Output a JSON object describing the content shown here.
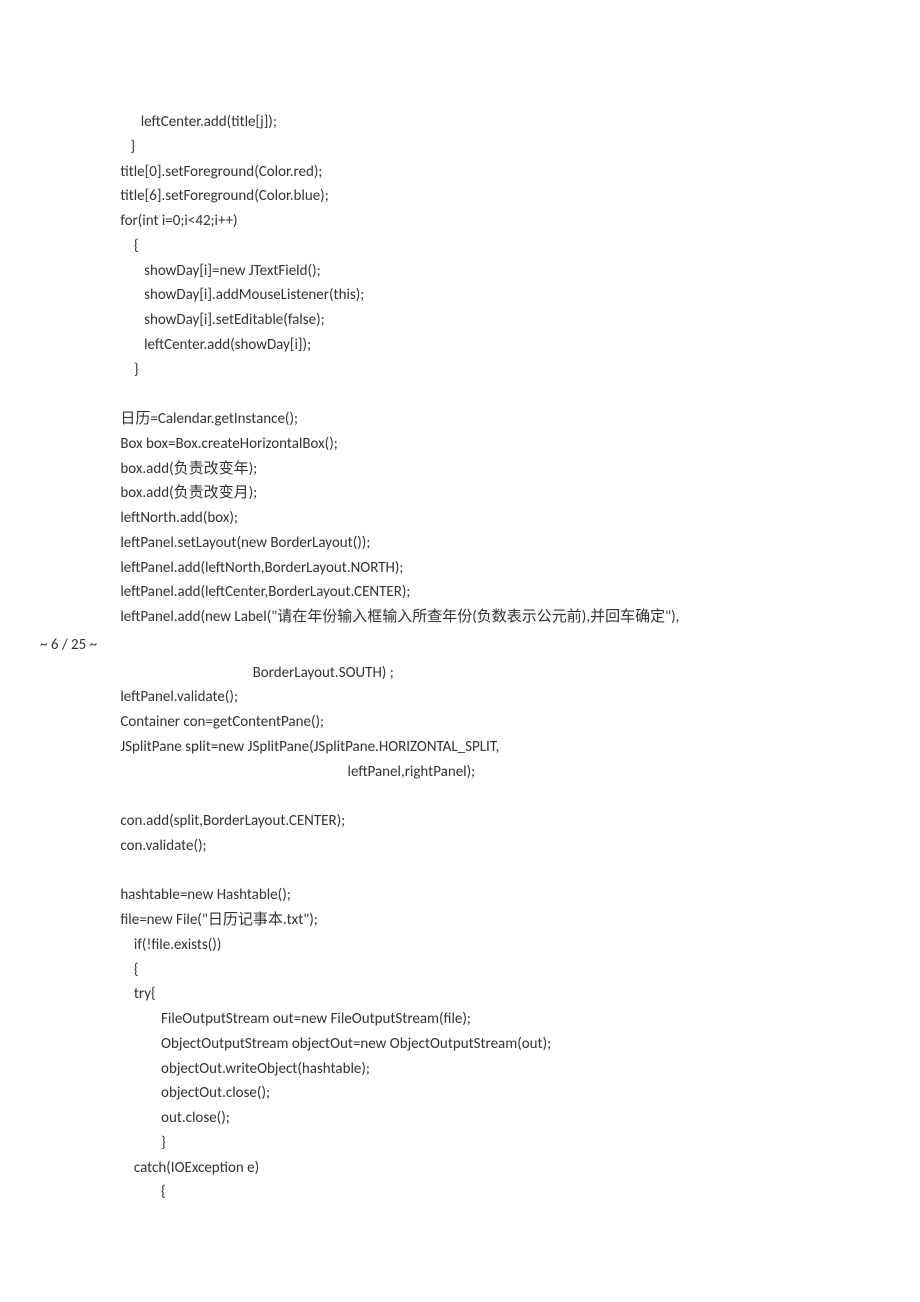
{
  "pageNumber": "~ 6 / 25 ~",
  "lines": [
    "            leftCenter.add(title[j]);",
    "         }",
    "      title[0].setForeground(Color.red);",
    "      title[6].setForeground(Color.blue);",
    "      for(int i=0;i<42;i++)",
    "          {",
    "             showDay[i]=new JTextField();",
    "             showDay[i].addMouseListener(this);",
    "             showDay[i].setEditable(false);",
    "             leftCenter.add(showDay[i]);",
    "          }",
    "",
    "      日历=Calendar.getInstance();",
    "      Box box=Box.createHorizontalBox();",
    "      box.add(负责改变年);",
    "      box.add(负责改变月);",
    "      leftNorth.add(box);",
    "      leftPanel.setLayout(new BorderLayout());",
    "      leftPanel.add(leftNorth,BorderLayout.NORTH);",
    "      leftPanel.add(leftCenter,BorderLayout.CENTER);",
    "      leftPanel.add(new Label(\"请在年份输入框输入所查年份(负数表示公元前),并回车确定\"),"
  ],
  "lines2": [
    "                                             BorderLayout.SOUTH) ;",
    "      leftPanel.validate();",
    "      Container con=getContentPane();",
    "      JSplitPane split=new JSplitPane(JSplitPane.HORIZONTAL_SPLIT,",
    "                                                                         leftPanel,rightPanel);",
    "",
    "      con.add(split,BorderLayout.CENTER);",
    "      con.validate();",
    "",
    "      hashtable=new Hashtable();",
    "      file=new File(\"日历记事本.txt\");",
    "          if(!file.exists())",
    "          {",
    "          try{",
    "                  FileOutputStream out=new FileOutputStream(file);",
    "                  ObjectOutputStream objectOut=new ObjectOutputStream(out);",
    "                  objectOut.writeObject(hashtable);",
    "                  objectOut.close();",
    "                  out.close();",
    "                  }",
    "          catch(IOException e)",
    "                  {"
  ]
}
